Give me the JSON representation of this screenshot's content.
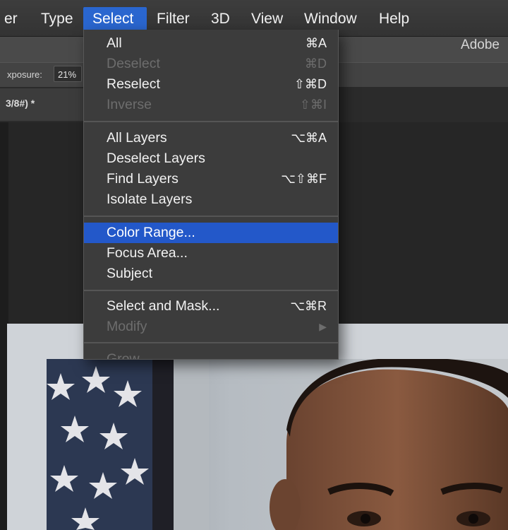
{
  "menubar": {
    "items": [
      {
        "label": "er"
      },
      {
        "label": "Type"
      },
      {
        "label": "Select"
      },
      {
        "label": "Filter"
      },
      {
        "label": "3D"
      },
      {
        "label": "View"
      },
      {
        "label": "Window"
      },
      {
        "label": "Help"
      }
    ],
    "active": "Select"
  },
  "app": {
    "brand_text": "Adobe"
  },
  "options_bar": {
    "exposure_label": "xposure:",
    "exposure_value": "21%"
  },
  "document_tab": {
    "title": "3/8#) *"
  },
  "select_menu": {
    "groups": [
      [
        {
          "label": "All",
          "shortcut": "⌘A",
          "enabled": true
        },
        {
          "label": "Deselect",
          "shortcut": "⌘D",
          "enabled": false
        },
        {
          "label": "Reselect",
          "shortcut": "⇧⌘D",
          "enabled": true
        },
        {
          "label": "Inverse",
          "shortcut": "⇧⌘I",
          "enabled": false
        }
      ],
      [
        {
          "label": "All Layers",
          "shortcut": "⌥⌘A",
          "enabled": true
        },
        {
          "label": "Deselect Layers",
          "shortcut": "",
          "enabled": true
        },
        {
          "label": "Find Layers",
          "shortcut": "⌥⇧⌘F",
          "enabled": true
        },
        {
          "label": "Isolate Layers",
          "shortcut": "",
          "enabled": true
        }
      ],
      [
        {
          "label": "Color Range...",
          "shortcut": "",
          "enabled": true,
          "highlighted": true
        },
        {
          "label": "Focus Area...",
          "shortcut": "",
          "enabled": true
        },
        {
          "label": "Subject",
          "shortcut": "",
          "enabled": true
        }
      ],
      [
        {
          "label": "Select and Mask...",
          "shortcut": "⌥⌘R",
          "enabled": true
        },
        {
          "label": "Modify",
          "shortcut": "▶",
          "enabled": false
        }
      ],
      [
        {
          "label": "Grow",
          "shortcut": "",
          "enabled": false
        }
      ]
    ]
  },
  "colors": {
    "menu_highlight": "#2358c9",
    "menubar_active": "#2a66cf",
    "menu_bg": "#3c3c3c",
    "disabled_text": "#6d6d6d"
  }
}
